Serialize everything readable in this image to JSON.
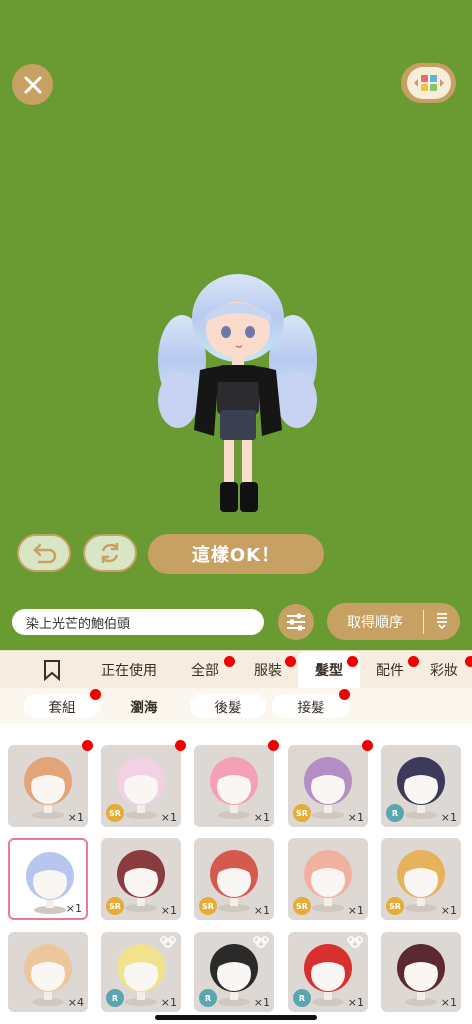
{
  "header": {
    "close_icon": "close-icon",
    "menu_icon": "closet-menu-icon"
  },
  "actions": {
    "undo_icon": "undo-icon",
    "refresh_icon": "refresh-icon",
    "ok_label": "這樣OK！"
  },
  "search": {
    "value": "染上光芒的鮑伯頭"
  },
  "sort": {
    "label": "取得順序",
    "icon": "sort-icon"
  },
  "main_tabs": [
    {
      "label": "",
      "icon": "bookmark-icon"
    },
    {
      "label": "正在使用"
    },
    {
      "label": "全部"
    },
    {
      "label": "服裝"
    },
    {
      "label": "髮型"
    },
    {
      "label": "配件"
    },
    {
      "label": "彩妝"
    }
  ],
  "sub_tabs": [
    {
      "label": "套組"
    },
    {
      "label": "瀏海"
    },
    {
      "label": "後髮"
    },
    {
      "label": "接髮"
    }
  ],
  "items": [
    {
      "count": "×1",
      "badge": "",
      "new": true
    },
    {
      "count": "×1",
      "badge": "SR",
      "new": true
    },
    {
      "count": "×1",
      "badge": "",
      "new": true
    },
    {
      "count": "×1",
      "badge": "SR",
      "new": true
    },
    {
      "count": "×1",
      "badge": "R",
      "new": false
    },
    {
      "count": "×1",
      "badge": "",
      "new": false,
      "selected": true
    },
    {
      "count": "×1",
      "badge": "SR",
      "new": false
    },
    {
      "count": "×1",
      "badge": "SR",
      "new": false
    },
    {
      "count": "×1",
      "badge": "SR",
      "new": false
    },
    {
      "count": "×1",
      "badge": "SR",
      "new": false
    },
    {
      "count": "×4",
      "badge": "",
      "new": false
    },
    {
      "count": "×1",
      "badge": "R",
      "new": false
    },
    {
      "count": "×1",
      "badge": "R",
      "new": false
    },
    {
      "count": "×1",
      "badge": "R",
      "new": false
    },
    {
      "count": "×1",
      "badge": "",
      "new": false
    }
  ],
  "colors": {
    "background": "#6a9a32",
    "accent": "#c7a064",
    "new_dot": "#f20000",
    "selected_border": "#e87c94"
  }
}
